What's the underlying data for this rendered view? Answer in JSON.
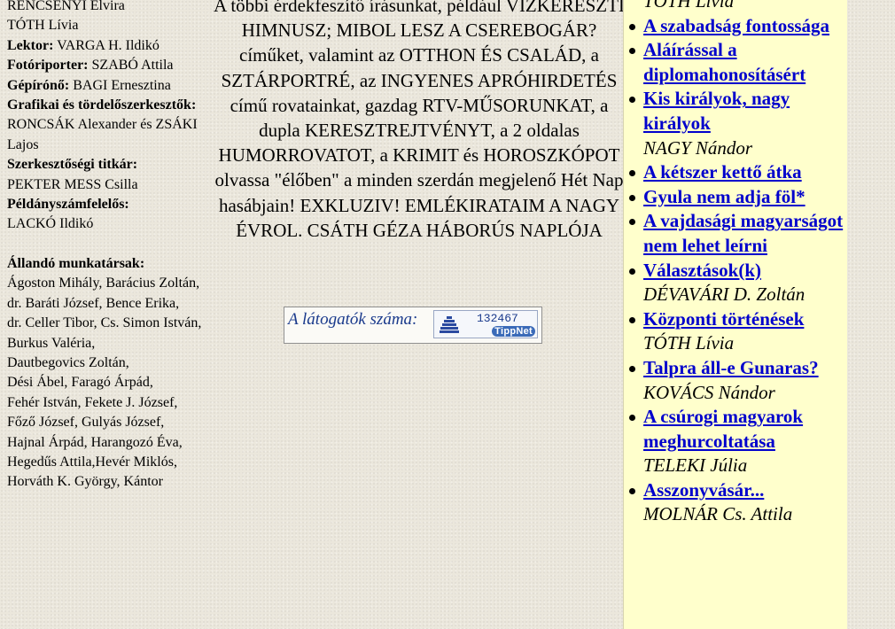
{
  "left": {
    "lines": [
      {
        "label": "",
        "text": "RENCSÉNYI Elvira"
      },
      {
        "label": "",
        "text": "TÓTH Lívia"
      },
      {
        "label": "Lektor:",
        "text": " VARGA H. Ildikó"
      },
      {
        "label": "Fotóriporter:",
        "text": " SZABÓ Attila"
      },
      {
        "label": "Gépírónő:",
        "text": " BAGI Ernesztina"
      },
      {
        "label": "Grafikai és tördelőszerkesztők:",
        "text": ""
      },
      {
        "label": "",
        "text": "RONCSÁK Alexander és ZSÁKI Lajos"
      },
      {
        "label": "Szerkesztőségi titkár:",
        "text": ""
      },
      {
        "label": "",
        "text": "PEKTER MESS Csilla"
      },
      {
        "label": "Példányszámfelelős:",
        "text": ""
      },
      {
        "label": "",
        "text": "LACKÓ Ildikó"
      }
    ],
    "staff_heading": "Állandó munkatársak:",
    "staff": [
      "Ágoston Mihály, Barácius Zoltán,",
      "dr. Baráti József, Bence Erika,",
      "dr. Celler Tibor, Cs. Simon István,",
      "Burkus Valéria,",
      "Dautbegovics Zoltán,",
      "Dési Ábel, Faragó Árpád,",
      "Fehér István, Fekete J. József,",
      "Főző József, Gulyás József,",
      "Hajnal Árpád, Harangozó Éva,",
      "Hegedűs Attila,Hevér Miklós,",
      "Horváth K. György, Kántor"
    ]
  },
  "center": {
    "text": "A többi érdekfeszítő írásunkat, például VÍZKERESZTI HIMNUSZ; MIBOL LESZ A CSEREBOGÁR? címűket, valamint az OTTHON ÉS CSALÁD, a SZTÁRPORTRÉ, az INGYENES APRÓHIRDETÉS című rovatainkat, gazdag RTV-MŰSORUNKAT, a dupla KERESZTREJTVÉNYT, a 2 oldalas HUMORROVATOT, a KRIMIT és HOROSZKÓPOT olvassa \"élőben\" a minden szerdán megjelenő Hét Nap hasábjain! EXKLUZIV! EMLÉKIRATAIM A NAGY ÉVROL. CSÁTH GÉZA HÁBORÚS NAPLÓJA"
  },
  "counter": {
    "label": "A látogatók száma:",
    "value": "132467",
    "brand": "TippNet"
  },
  "right": {
    "items": [
      {
        "title": "",
        "author": "TÓTH Lívia"
      },
      {
        "title": "A szabadság fontossága",
        "author": ""
      },
      {
        "title": "Aláírással a diplomahonosításért",
        "author": ""
      },
      {
        "title": "Kis királyok, nagy királyok",
        "author": "NAGY Nándor"
      },
      {
        "title": "A kétszer kettő átka",
        "author": ""
      },
      {
        "title": "Gyula nem adja föl*",
        "author": ""
      },
      {
        "title": "A vajdasági magyarságot nem lehet leírni",
        "author": ""
      },
      {
        "title": "Választások(k)",
        "author": "DÉVAVÁRI D. Zoltán"
      },
      {
        "title": "Központi történések",
        "author": "TÓTH Lívia"
      },
      {
        "title": "Talpra áll-e Gunaras?",
        "author": "KOVÁCS Nándor"
      },
      {
        "title": "A csúrogi magyarok meghurcoltatása",
        "author": "TELEKI Júlia"
      },
      {
        "title": "Asszonyvásár...",
        "author": "MOLNÁR Cs. Attila"
      }
    ]
  }
}
